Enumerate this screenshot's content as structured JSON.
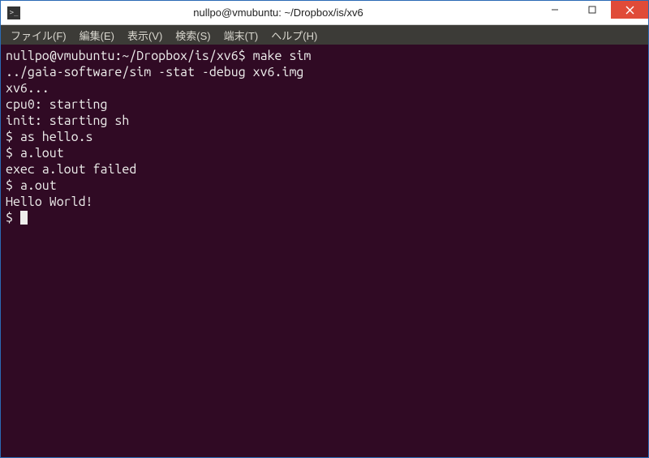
{
  "window": {
    "title": "nullpo@vmubuntu: ~/Dropbox/is/xv6"
  },
  "menubar": {
    "items": [
      "ファイル(F)",
      "編集(E)",
      "表示(V)",
      "検索(S)",
      "端末(T)",
      "ヘルプ(H)"
    ]
  },
  "terminal": {
    "lines": [
      {
        "prompt": "nullpo@vmubuntu:~/Dropbox/is/xv6$ ",
        "cmd": "make sim"
      },
      {
        "text": "../gaia-software/sim -stat -debug xv6.img"
      },
      {
        "text": "xv6..."
      },
      {
        "text": "cpu0: starting"
      },
      {
        "text": "init: starting sh"
      },
      {
        "text": "$ as hello.s"
      },
      {
        "text": "$ a.lout"
      },
      {
        "text": "exec a.lout failed"
      },
      {
        "text": "$ a.out"
      },
      {
        "text": "Hello World!"
      },
      {
        "text": "$ ",
        "cursor": true
      }
    ]
  }
}
